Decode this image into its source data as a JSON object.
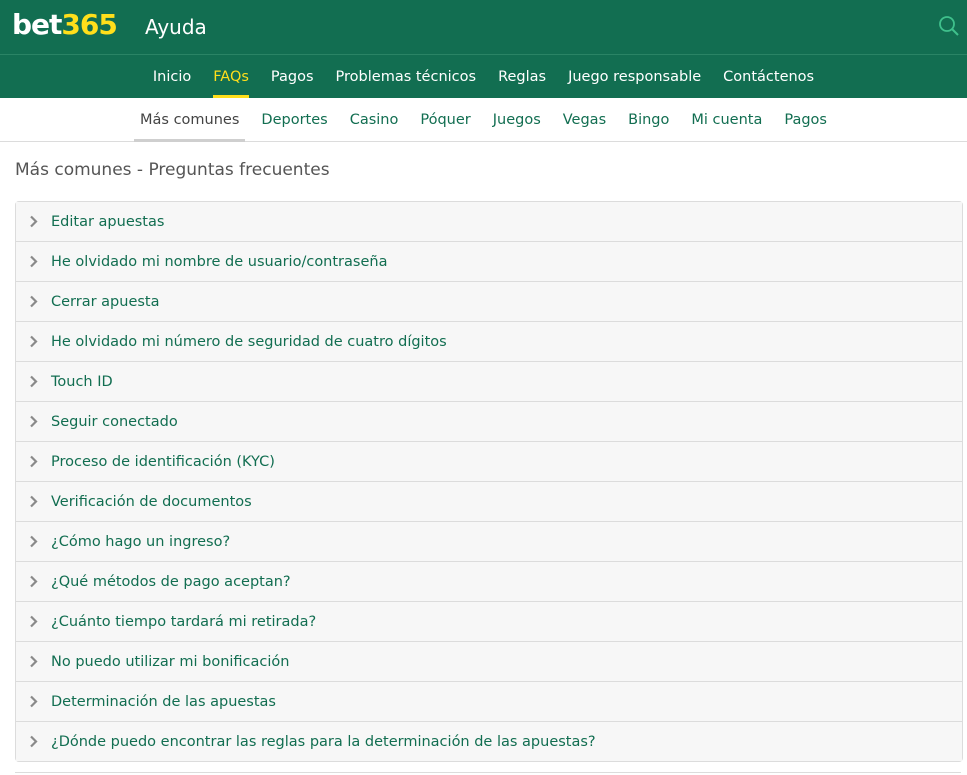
{
  "header": {
    "logo_part1": "bet",
    "logo_part2": "365",
    "title": "Ayuda",
    "search_icon": "search-icon",
    "brand_green": "#126e51",
    "brand_yellow": "#ffdf1b"
  },
  "main_nav": [
    {
      "label": "Inicio",
      "active": false
    },
    {
      "label": "FAQs",
      "active": true
    },
    {
      "label": "Pagos",
      "active": false
    },
    {
      "label": "Problemas técnicos",
      "active": false
    },
    {
      "label": "Reglas",
      "active": false
    },
    {
      "label": "Juego responsable",
      "active": false
    },
    {
      "label": "Contáctenos",
      "active": false
    }
  ],
  "sub_nav": [
    {
      "label": "Más comunes",
      "active": true
    },
    {
      "label": "Deportes",
      "active": false
    },
    {
      "label": "Casino",
      "active": false
    },
    {
      "label": "Póquer",
      "active": false
    },
    {
      "label": "Juegos",
      "active": false
    },
    {
      "label": "Vegas",
      "active": false
    },
    {
      "label": "Bingo",
      "active": false
    },
    {
      "label": "Mi cuenta",
      "active": false
    },
    {
      "label": "Pagos",
      "active": false
    }
  ],
  "page_title": "Más comunes - Preguntas frecuentes",
  "faqs": [
    "Editar apuestas",
    "He olvidado mi nombre de usuario/contraseña",
    "Cerrar apuesta",
    "He olvidado mi número de seguridad de cuatro dígitos",
    "Touch ID",
    "Seguir conectado",
    "Proceso de identificación (KYC)",
    "Verificación de documentos",
    "¿Cómo hago un ingreso?",
    "¿Qué métodos de pago aceptan?",
    "¿Cuánto tiempo tardará mi retirada?",
    "No puedo utilizar mi bonificación",
    "Determinación de las apuestas",
    "¿Dónde puedo encontrar las reglas para la determinación de las apuestas?"
  ]
}
